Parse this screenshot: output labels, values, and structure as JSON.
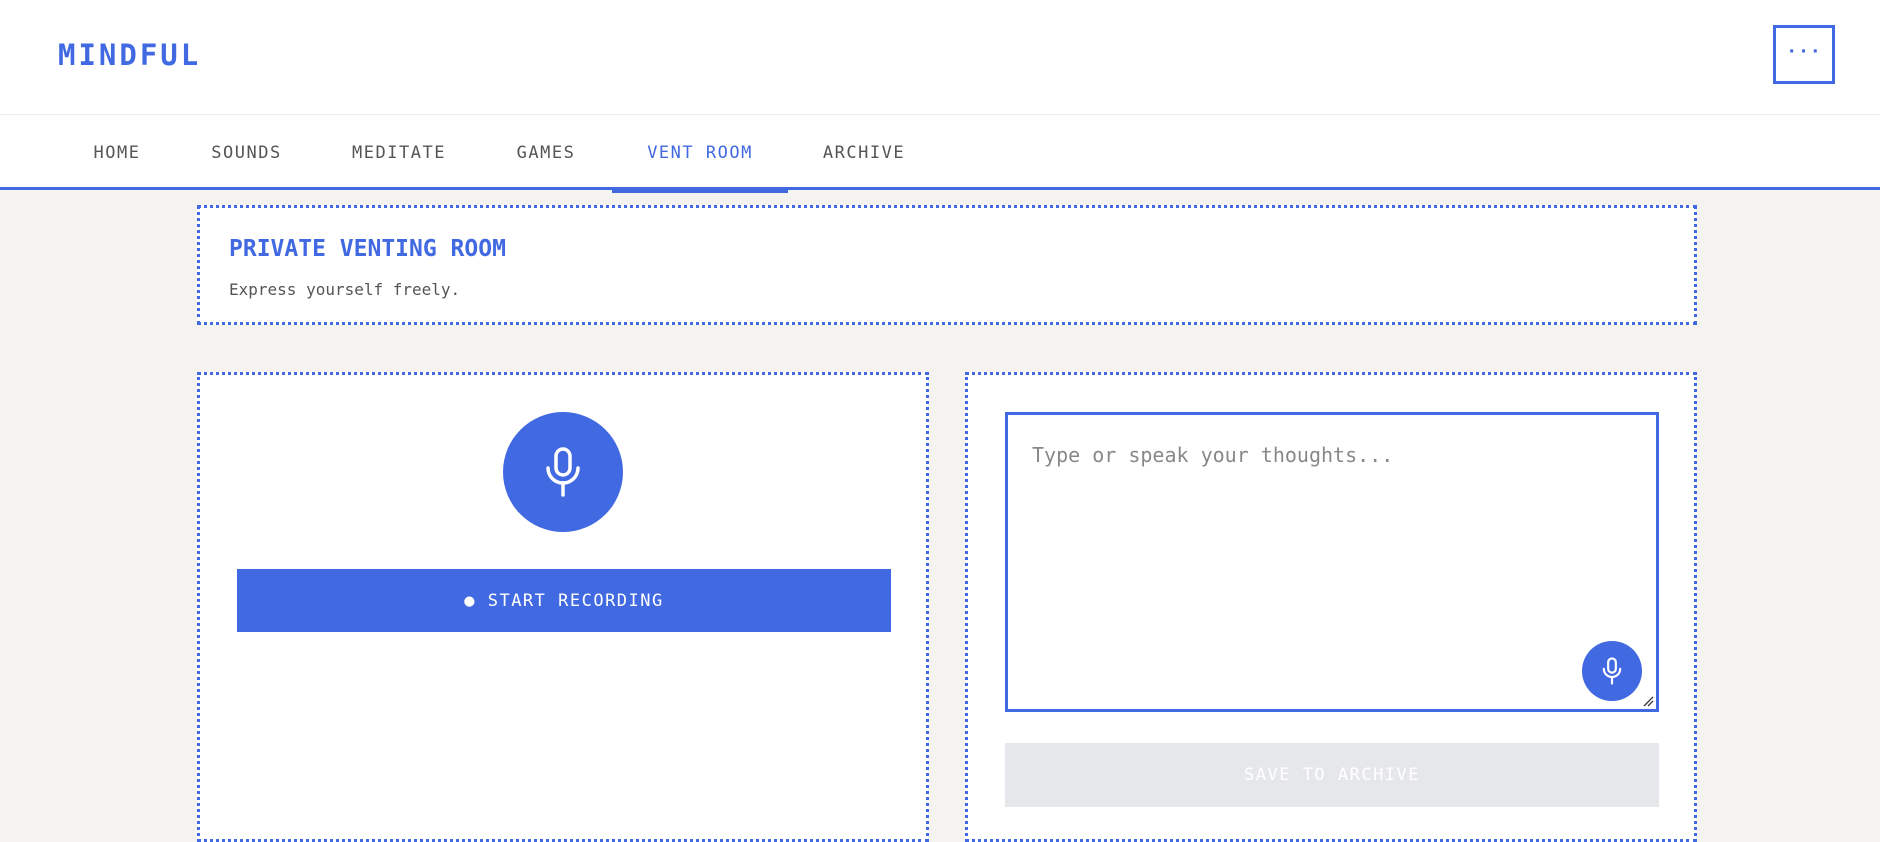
{
  "header": {
    "logo": "MINDFUL",
    "menu_label": "···"
  },
  "nav": {
    "tabs": [
      {
        "label": "HOME"
      },
      {
        "label": "SOUNDS"
      },
      {
        "label": "MEDITATE"
      },
      {
        "label": "GAMES"
      },
      {
        "label": "VENT ROOM",
        "active": true
      },
      {
        "label": "ARCHIVE"
      }
    ]
  },
  "intro": {
    "title": "PRIVATE VENTING ROOM",
    "subtitle": "Express yourself freely."
  },
  "recorder": {
    "mic_icon": "microphone-icon",
    "start_label": "● START RECORDING"
  },
  "journal": {
    "placeholder": "Type or speak your thoughts...",
    "value": "",
    "mic_icon": "microphone-icon",
    "save_label": "SAVE TO ARCHIVE"
  },
  "colors": {
    "accent": "#4169e1",
    "background": "#f4f3f0",
    "disabled": "#e6e7ea"
  }
}
